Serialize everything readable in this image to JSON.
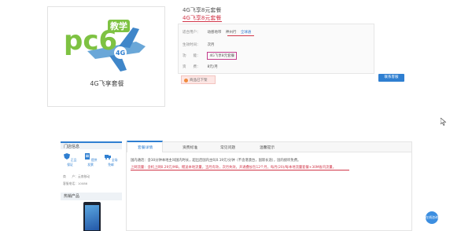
{
  "product": {
    "logo_text": "pc6",
    "logo_badge": "教学",
    "logo_4g": "4G",
    "image_caption": "4G飞享套餐",
    "title": "4G飞享8元套餐",
    "title_repeat": "4G飞享8元套餐"
  },
  "info": {
    "rows": [
      {
        "label": "适合用户：",
        "values": [
          "动感地带",
          "神州行",
          "全球通"
        ]
      },
      {
        "label": "生效时间：",
        "values": [
          "次月"
        ]
      },
      {
        "label": "功　　能：",
        "values": [
          "4G飞享8元套餐"
        ]
      },
      {
        "label": "资　　费：",
        "values": [
          "8元/月"
        ]
      }
    ]
  },
  "status_text": "商品已下架",
  "contact_button": "联系客服",
  "sidebar": {
    "heading": "门店信息",
    "icons": [
      {
        "label": "正品保证",
        "color": "#2f7fd1"
      },
      {
        "label": "提供发票",
        "color": "#2f7fd1"
      },
      {
        "label": "全场免邮",
        "color": "#2f7fd1"
      }
    ],
    "lines": [
      "商　　户：云南移动",
      "客服电话：10086"
    ],
    "hot_heading": "热销产品"
  },
  "tabs": [
    {
      "label": "套餐详情",
      "active": true
    },
    {
      "label": "资费标准",
      "active": false
    },
    {
      "label": "常见问题",
      "active": false
    },
    {
      "label": "温馨提示",
      "active": false
    }
  ],
  "details": [
    "国内通话：含30分钟本地主叫国内时长，超出后国内主叫0.19元/分钟（不含港澳台，国际长途），国内接听免费。",
    "上网流量：含机上网0.29元/MB，赠送本地流量，当月有效，次月失效，开通叠加包12个月，每月(20)/每本地流量套餐+30M省内流量。"
  ],
  "chat_label": "在线咨询",
  "colors": {
    "accent": "#2f7fd1",
    "highlight": "#d2374a",
    "logo_green": "#7ec242"
  }
}
